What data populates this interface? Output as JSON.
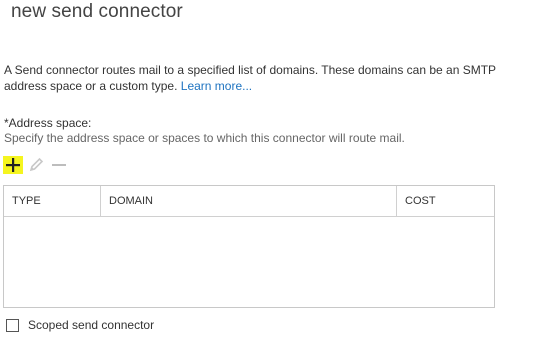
{
  "page": {
    "title": "new send connector"
  },
  "description": {
    "text": "A Send connector routes mail to a specified list of domains. These domains can be an SMTP address space or a custom type.",
    "link": "Learn more..."
  },
  "address_space": {
    "label": "*Address space:",
    "hint": "Specify the address space or spaces to which this connector will route mail."
  },
  "toolbar": {
    "add_icon": "plus-icon",
    "edit_icon": "pencil-icon",
    "remove_icon": "minus-icon",
    "highlight_color": "#f5f51f"
  },
  "grid": {
    "columns": [
      "TYPE",
      "DOMAIN",
      "COST"
    ],
    "rows": []
  },
  "scoped": {
    "label": "Scoped send connector",
    "checked": false
  }
}
